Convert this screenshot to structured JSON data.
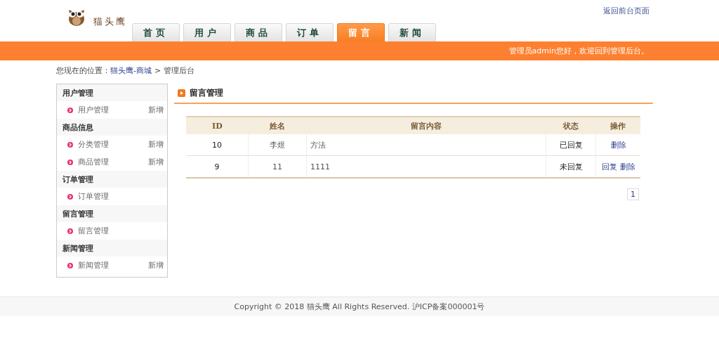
{
  "header": {
    "logo_text": "猫头鹰",
    "top_link": "返回前台页面",
    "tabs": [
      {
        "label": "首页",
        "selected": false
      },
      {
        "label": "用户",
        "selected": false
      },
      {
        "label": "商品",
        "selected": false
      },
      {
        "label": "订单",
        "selected": false
      },
      {
        "label": "留言",
        "selected": true
      },
      {
        "label": "新闻",
        "selected": false
      }
    ],
    "welcome": "管理员admin您好，欢迎回到管理后台。"
  },
  "breadcrumb": {
    "label": "您现在的位置：",
    "link": "猫头鹰-商城",
    "separator": ">",
    "current": "管理后台"
  },
  "sidebar": {
    "groups": [
      {
        "title": "用户管理",
        "items": [
          {
            "label": "用户管理",
            "action": "新增"
          }
        ]
      },
      {
        "title": "商品信息",
        "items": [
          {
            "label": "分类管理",
            "action": "新增"
          },
          {
            "label": "商品管理",
            "action": "新增"
          }
        ]
      },
      {
        "title": "订单管理",
        "items": [
          {
            "label": "订单管理"
          }
        ]
      },
      {
        "title": "留言管理",
        "items": [
          {
            "label": "留言管理"
          }
        ]
      },
      {
        "title": "新闻管理",
        "items": [
          {
            "label": "新闻管理",
            "action": "新增"
          }
        ]
      }
    ]
  },
  "panel": {
    "title": "留言管理",
    "table": {
      "columns": [
        "ID",
        "姓名",
        "留言内容",
        "状态",
        "操作"
      ],
      "rows": [
        {
          "cells": [
            "10",
            "李煜",
            "方法",
            "已回复"
          ],
          "actions": [
            "删除"
          ]
        },
        {
          "cells": [
            "9",
            "11",
            "1111",
            "未回复"
          ],
          "actions": [
            "回复",
            "删除"
          ]
        }
      ]
    },
    "pagination": [
      "1"
    ]
  },
  "footer": "Copyright © 2018 猫头鹰 All Rights Reserved. 沪ICP备案000001号"
}
